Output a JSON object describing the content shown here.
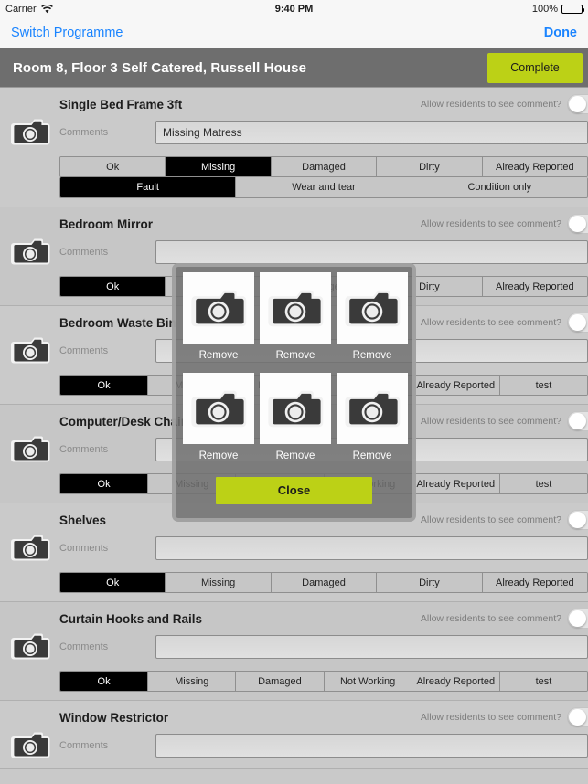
{
  "statusbar": {
    "carrier": "Carrier",
    "wifi_icon": "wifi-icon",
    "time": "9:40 PM",
    "battery_percent": "100%",
    "battery_icon": "battery-full-icon"
  },
  "navbar": {
    "switch_programme": "Switch Programme",
    "done": "Done"
  },
  "titlebar": {
    "room_title": "Room 8, Floor 3 Self Catered, Russell House",
    "complete_label": "Complete",
    "complete_color": "#bcd116",
    "bar_color": "#6e6e6e"
  },
  "common": {
    "comments_label": "Comments",
    "allow_residents_label": "Allow residents to see comment?",
    "camera_icon": "camera-icon",
    "comment_placeholder": ""
  },
  "items": [
    {
      "title": "Single Bed Frame 3ft",
      "comment": "Missing Matress",
      "rows": [
        {
          "options": [
            "Ok",
            "Missing",
            "Damaged",
            "Dirty",
            "Already Reported"
          ],
          "selected": 1
        },
        {
          "options": [
            "Fault",
            "Wear and tear",
            "Condition only"
          ],
          "selected": 0
        }
      ]
    },
    {
      "title": "Bedroom Mirror",
      "comment": "",
      "rows": [
        {
          "options": [
            "Ok",
            "Missing",
            "Damaged",
            "Dirty",
            "Already Reported"
          ],
          "selected": 0
        }
      ]
    },
    {
      "title": "Bedroom Waste Bin",
      "comment": "",
      "rows": [
        {
          "options": [
            "Ok",
            "Missing",
            "Damaged",
            "Not Working",
            "Already Reported",
            "test"
          ],
          "selected": 0
        }
      ]
    },
    {
      "title": "Computer/Desk Chair",
      "comment": "",
      "rows": [
        {
          "options": [
            "Ok",
            "Missing",
            "Damaged",
            "Not Working",
            "Already Reported",
            "test"
          ],
          "selected": 0
        }
      ]
    },
    {
      "title": "Shelves",
      "comment": "",
      "rows": [
        {
          "options": [
            "Ok",
            "Missing",
            "Damaged",
            "Dirty",
            "Already Reported"
          ],
          "selected": 0
        }
      ]
    },
    {
      "title": "Curtain Hooks and Rails",
      "comment": "",
      "rows": [
        {
          "options": [
            "Ok",
            "Missing",
            "Damaged",
            "Not Working",
            "Already Reported",
            "test"
          ],
          "selected": 0
        }
      ]
    },
    {
      "title": "Window Restrictor",
      "comment": "",
      "rows": []
    }
  ],
  "modal": {
    "thumbnails": [
      {
        "icon": "camera-icon",
        "remove_label": "Remove"
      },
      {
        "icon": "camera-icon",
        "remove_label": "Remove"
      },
      {
        "icon": "camera-icon",
        "remove_label": "Remove"
      },
      {
        "icon": "camera-icon",
        "remove_label": "Remove"
      },
      {
        "icon": "camera-icon",
        "remove_label": "Remove"
      },
      {
        "icon": "camera-icon",
        "remove_label": "Remove"
      }
    ],
    "close_label": "Close",
    "close_color": "#bcd116"
  }
}
